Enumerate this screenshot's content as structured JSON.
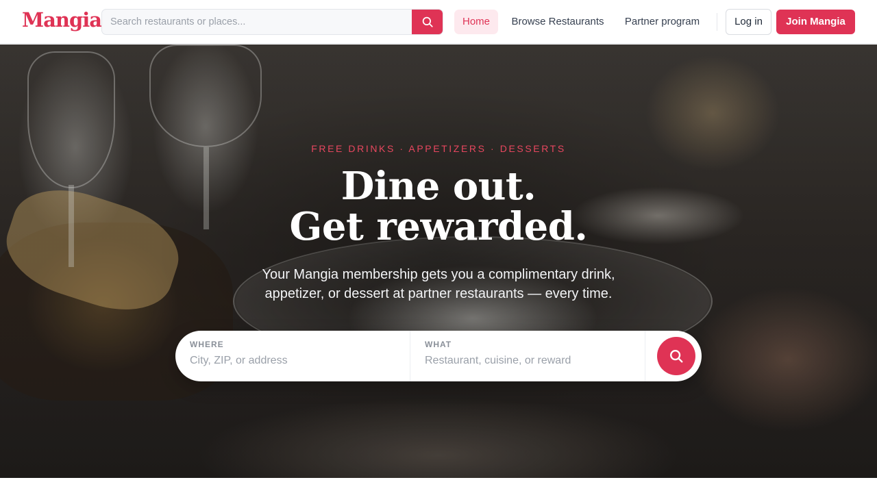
{
  "brand": {
    "name": "Mangia",
    "accent_color": "#df3355"
  },
  "header": {
    "search": {
      "placeholder": "Search restaurants or places...",
      "icon": "search-icon"
    },
    "nav": {
      "home": "Home",
      "browse": "Browse Restaurants",
      "partner": "Partner program"
    },
    "login_label": "Log in",
    "join_label": "Join Mangia"
  },
  "hero": {
    "eyebrow": "FREE DRINKS · APPETIZERS · DESSERTS",
    "headline_line1": "Dine out.",
    "headline_line2": "Get rewarded.",
    "subtitle": "Your Mangia membership gets you a complimentary drink, appetizer, or dessert at partner restaurants — every time.",
    "finder": {
      "where_label": "WHERE",
      "where_placeholder": "City, ZIP, or address",
      "what_label": "WHAT",
      "what_placeholder": "Restaurant, cuisine, or reward",
      "submit_icon": "search-icon"
    }
  }
}
